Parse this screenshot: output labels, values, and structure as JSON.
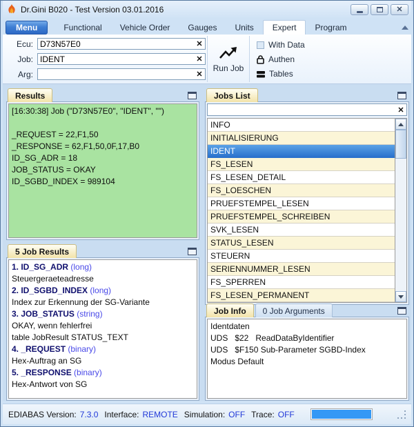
{
  "window": {
    "title": "Dr.Gini B020 - Test Version 03.01.2016"
  },
  "ribbon": {
    "menu_label": "Menu",
    "tabs": [
      "Functional",
      "Vehicle Order",
      "Gauges",
      "Units",
      "Expert",
      "Program"
    ],
    "active_tab": "Expert",
    "fields": [
      {
        "label": "Ecu:",
        "value": "D73N57E0"
      },
      {
        "label": "Job:",
        "value": "IDENT"
      },
      {
        "label": "Arg:",
        "value": ""
      }
    ],
    "run_button_label": "Run Job",
    "options": [
      {
        "label": "With Data",
        "icon": "checkbox-icon"
      },
      {
        "label": "Authen",
        "icon": "lock-icon"
      },
      {
        "label": "Tables",
        "icon": "tables-icon"
      }
    ]
  },
  "results_panel": {
    "tab": "Results",
    "log_lines": [
      "[16:30:38] Job (\"D73N57E0\", \"IDENT\", \"\")",
      "",
      "_REQUEST = 22,F1,50",
      "_RESPONSE = 62,F1,50,0F,17,B0",
      "ID_SG_ADR = 18",
      "JOB_STATUS = OKAY",
      "ID_SGBD_INDEX = 989104"
    ]
  },
  "jobs_list_panel": {
    "tab": "Jobs List",
    "filter_value": "",
    "selected": "IDENT",
    "jobs": [
      "INFO",
      "INITIALISIERUNG",
      "IDENT",
      "FS_LESEN",
      "FS_LESEN_DETAIL",
      "FS_LOESCHEN",
      "PRUEFSTEMPEL_LESEN",
      "PRUEFSTEMPEL_SCHREIBEN",
      "SVK_LESEN",
      "STATUS_LESEN",
      "STEUERN",
      "SERIENNUMMER_LESEN",
      "FS_SPERREN",
      "FS_LESEN_PERMANENT"
    ]
  },
  "job_results_panel": {
    "tab": "5 Job Results",
    "entries": [
      {
        "name": "1. ID_SG_ADR",
        "type": "(long)",
        "desc": [
          "Steuergeraeteadresse"
        ]
      },
      {
        "name": "2. ID_SGBD_INDEX",
        "type": "(long)",
        "desc": [
          "Index zur Erkennung der SG-Variante"
        ]
      },
      {
        "name": "3. JOB_STATUS",
        "type": "(string)",
        "desc": [
          "OKAY, wenn fehlerfrei",
          "table JobResult STATUS_TEXT"
        ]
      },
      {
        "name": "4. _REQUEST",
        "type": "(binary)",
        "desc": [
          "Hex-Auftrag an SG"
        ]
      },
      {
        "name": "5. _RESPONSE",
        "type": "(binary)",
        "desc": [
          "Hex-Antwort von SG"
        ]
      }
    ]
  },
  "job_info_panel": {
    "tabs": [
      "Job Info",
      "0 Job Arguments"
    ],
    "active_tab": "Job Info",
    "lines": [
      "Identdaten",
      "UDS   $22   ReadDataByIdentifier",
      "UDS   $F150 Sub-Parameter SGBD-Index",
      "Modus Default"
    ]
  },
  "status_bar": {
    "items": [
      {
        "label": "EDIABAS Version:",
        "value": "7.3.0"
      },
      {
        "label": "Interface:",
        "value": "REMOTE"
      },
      {
        "label": "Simulation:",
        "value": "OFF"
      },
      {
        "label": "Trace:",
        "value": "OFF"
      }
    ],
    "progress_percent": 100
  },
  "colors": {
    "accent_blue": "#2a71cc",
    "results_green": "#a9e3a1",
    "tab_cream": "#f2e3a9",
    "status_value_blue": "#2038d8",
    "progress_blue": "#3498f5"
  }
}
